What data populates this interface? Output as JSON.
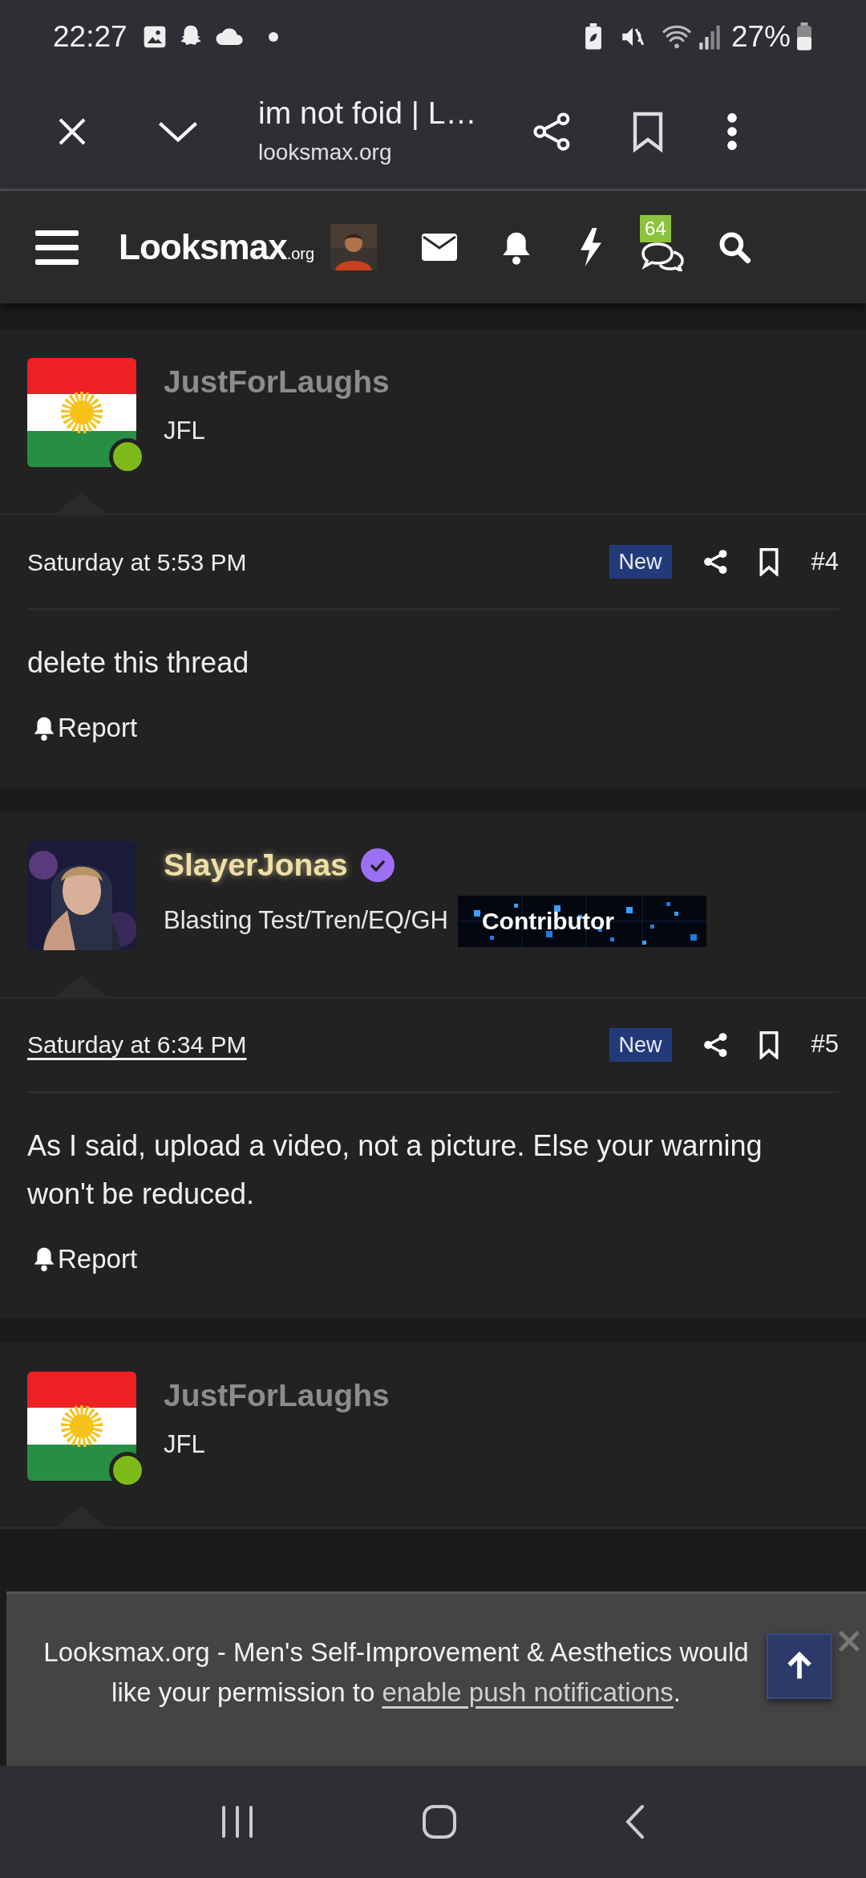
{
  "status_bar": {
    "time": "22:27",
    "battery": "27%"
  },
  "browser_bar": {
    "title": "im not foid | L…",
    "url": "looksmax.org"
  },
  "site_nav": {
    "logo": "Looksmax",
    "logo_suffix": ".org",
    "chat_badge": "64"
  },
  "posts": [
    {
      "author": "JustForLaughs",
      "color": "#8c8c8c",
      "verified": false,
      "avatar": {
        "kind": "flag",
        "online": true
      },
      "title": "JFL",
      "date": "Saturday at 5:53 PM",
      "date_underlined": false,
      "badge": "New",
      "number": "#4",
      "body": "delete this thread",
      "report": "Report"
    },
    {
      "author": "SlayerJonas",
      "color": "#eedfa8",
      "verified": true,
      "title": "Blasting Test/Tren/EQ/GH",
      "banner": "Contributor",
      "date": "Saturday at 6:34 PM",
      "date_underlined": true,
      "badge": "New",
      "number": "#5",
      "body": "As I said, upload a video, not a picture. Else your warning won't be reduced.",
      "report": "Report"
    },
    {
      "author": "JustForLaughs",
      "color": "#8c8c8c",
      "verified": false,
      "avatar": {
        "kind": "flag",
        "online": true
      },
      "title": "JFL"
    }
  ],
  "notification": {
    "text": "Looksmax.org - Men's Self-Improvement & Aesthetics would like your permission to ",
    "link": "enable push notifications",
    "end": "."
  }
}
